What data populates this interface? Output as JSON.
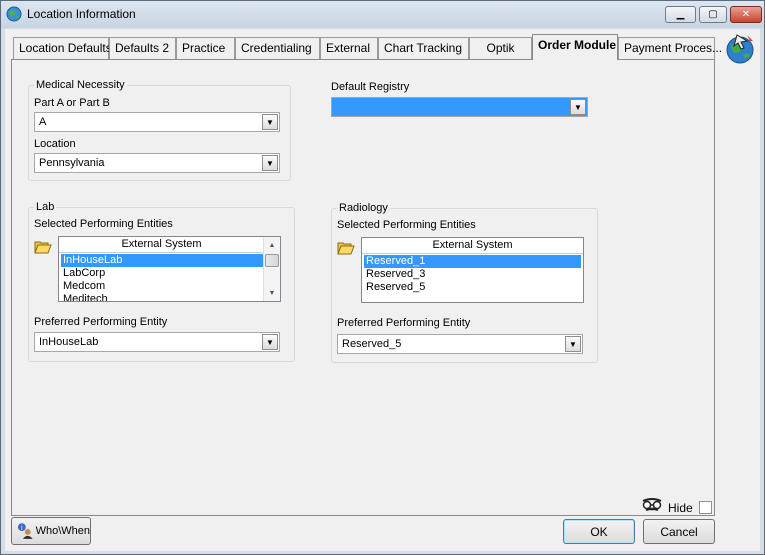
{
  "window": {
    "title": "Location Information",
    "minimize": "▁",
    "maximize": "▢",
    "close": "✕"
  },
  "tabs": [
    {
      "label": "Location Defaults"
    },
    {
      "label": "Defaults 2"
    },
    {
      "label": "Practice"
    },
    {
      "label": "Credentialing"
    },
    {
      "label": "External"
    },
    {
      "label": "Chart Tracking"
    },
    {
      "label": "Optik"
    },
    {
      "label": "Order Module"
    },
    {
      "label": "Payment Proces..."
    }
  ],
  "active_tab": "Order Module",
  "medical_necessity": {
    "group_title": "Medical Necessity",
    "part_label": "Part A or Part B",
    "part_value": "A",
    "location_label": "Location",
    "location_value": "Pennsylvania"
  },
  "default_registry": {
    "label": "Default Registry",
    "value": ""
  },
  "lab": {
    "group_title": "Lab",
    "selected_label": "Selected Performing Entities",
    "column_header": "External System",
    "items": [
      "InHouseLab",
      "LabCorp",
      "Medcom",
      "Meditech"
    ],
    "selected_item": "InHouseLab",
    "preferred_label": "Preferred Performing Entity",
    "preferred_value": "InHouseLab"
  },
  "radiology": {
    "group_title": "Radiology",
    "selected_label": "Selected Performing Entities",
    "column_header": "External System",
    "items": [
      "Reserved_1",
      "Reserved_3",
      "Reserved_5"
    ],
    "selected_item": "Reserved_1",
    "preferred_label": "Preferred Performing Entity",
    "preferred_value": "Reserved_5"
  },
  "footer": {
    "who_when": "Who\\When",
    "hide_label": "Hide",
    "hide_checked": false,
    "ok": "OK",
    "cancel": "Cancel"
  },
  "icons": {
    "app": "globe-icon",
    "side_logo": "globe-arrow-icon",
    "folder": "open-folder-icon",
    "hide_avatar": "disguise-icon",
    "info": "info-person-icon",
    "dropdown": "▼",
    "scroll_up": "▲",
    "scroll_down": "▼"
  },
  "colors": {
    "selection": "#3399ff",
    "titlebar": "#c8d4e2"
  }
}
